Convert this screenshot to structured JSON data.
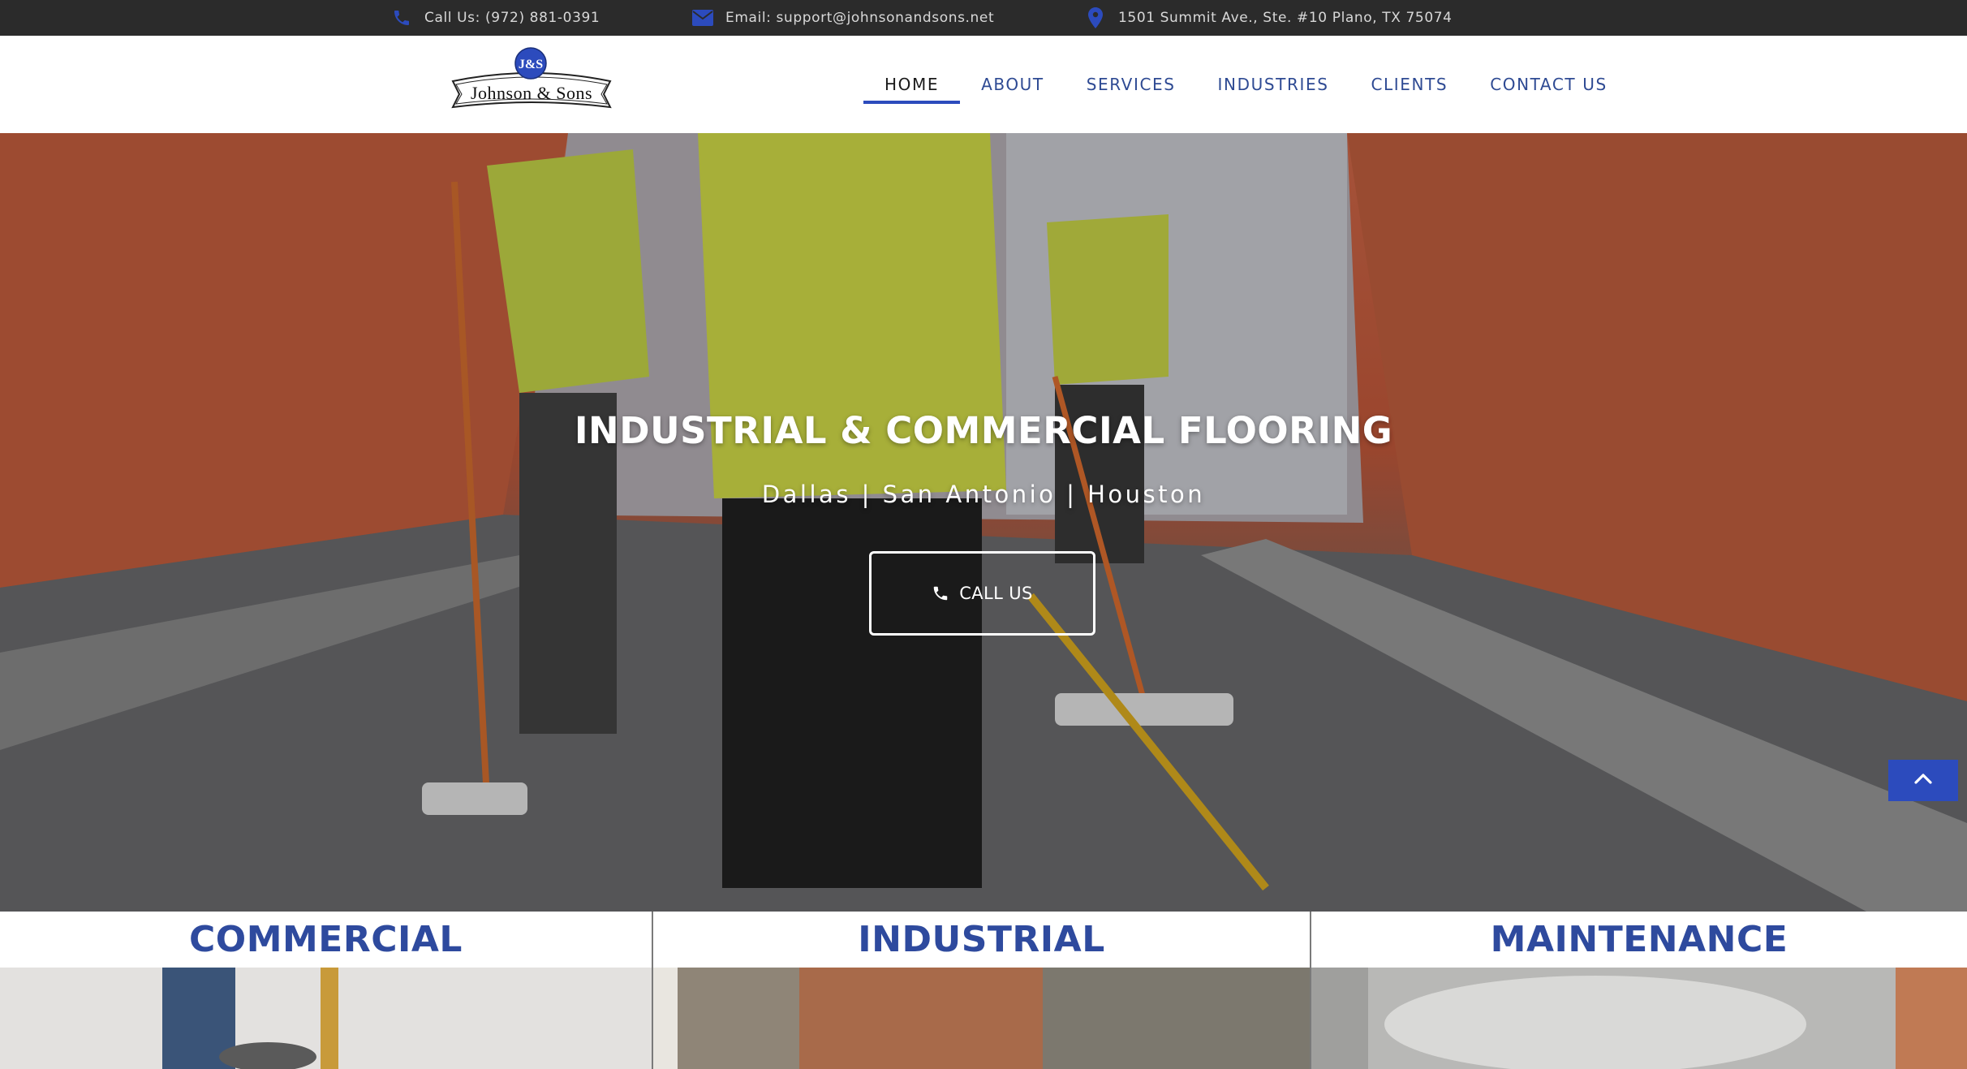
{
  "topbar": {
    "phone": "Call Us: (972) 881-0391",
    "email": "Email: support@johnsonandsons.net",
    "address": "1501 Summit Ave., Ste. #10 Plano, TX 75074"
  },
  "brand": {
    "logo_initials": "J&S",
    "logo_text": "Johnson & Sons",
    "accent": "#2c4bbd",
    "topbar_bg": "#2b2b2b",
    "heading_color": "#2e4a9e"
  },
  "nav": {
    "items": [
      {
        "label": "HOME",
        "active": true
      },
      {
        "label": "ABOUT",
        "active": false
      },
      {
        "label": "SERVICES",
        "active": false
      },
      {
        "label": "INDUSTRIES",
        "active": false
      },
      {
        "label": "CLIENTS",
        "active": false
      },
      {
        "label": "CONTACT US",
        "active": false
      }
    ]
  },
  "hero": {
    "title": "INDUSTRIAL & COMMERCIAL FLOORING",
    "subtitle": "Dallas | San Antonio | Houston",
    "cta_label": "CALL US",
    "cta_icon": "phone-icon"
  },
  "scroll_top": {
    "icon": "chevron-up-icon"
  },
  "cards": [
    {
      "title": "COMMERCIAL"
    },
    {
      "title": "INDUSTRIAL"
    },
    {
      "title": "MAINTENANCE"
    }
  ]
}
